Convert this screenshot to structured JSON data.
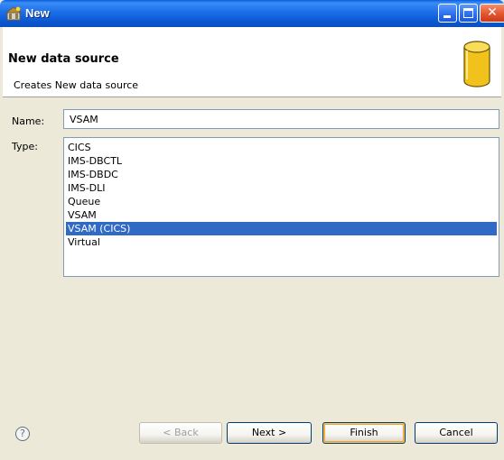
{
  "window": {
    "title": "New"
  },
  "banner": {
    "title": "New data source",
    "description": "Creates New data source"
  },
  "form": {
    "name_label": "Name:",
    "name_value": "VSAM",
    "type_label": "Type:",
    "types": [
      "CICS",
      "IMS-DBCTL",
      "IMS-DBDC",
      "IMS-DLI",
      "Queue",
      "VSAM",
      "VSAM (CICS)",
      "Virtual"
    ],
    "selected_type": "VSAM (CICS)"
  },
  "buttons": {
    "back": "< Back",
    "next": "Next >",
    "finish": "Finish",
    "cancel": "Cancel",
    "back_enabled": false
  },
  "icons": {
    "title": "wizard-app-icon",
    "banner": "database-cylinder-icon",
    "help": "help-icon"
  },
  "colors": {
    "selection": "#316ac5",
    "titlebar": "#0b57d0",
    "dialog_background": "#ece9d8",
    "database_icon": "#f2c21c"
  }
}
